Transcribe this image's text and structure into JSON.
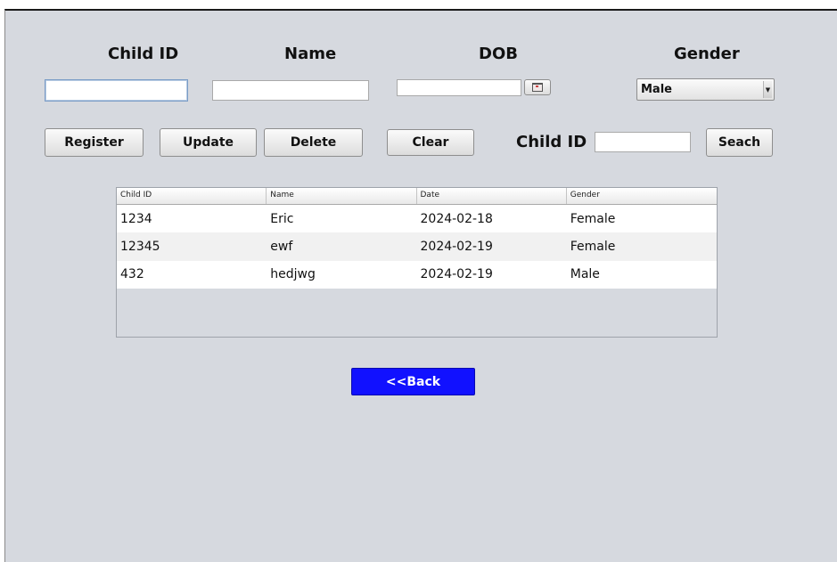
{
  "form": {
    "headers": {
      "child_id": "Child ID",
      "name": "Name",
      "dob": "DOB",
      "gender": "Gender"
    },
    "child_id_value": "",
    "name_value": "",
    "dob_value": "",
    "gender_selected": "Male"
  },
  "buttons": {
    "register": "Register",
    "update": "Update",
    "delete": "Delete",
    "clear": "Clear",
    "search": "Seach",
    "back": "<<Back"
  },
  "search": {
    "label": "Child ID",
    "value": ""
  },
  "icons": {
    "date_picker": "calendar-icon",
    "combo_arrow": "chevron-down-icon"
  },
  "colors": {
    "panel_bg": "#d6d9df",
    "back_button_bg": "#1111ff"
  },
  "table": {
    "columns": [
      "Child ID",
      "Name",
      "Date",
      "Gender"
    ],
    "rows": [
      [
        "1234",
        "Eric",
        "2024-02-18",
        "Female"
      ],
      [
        "12345",
        "ewf",
        "2024-02-19",
        "Female"
      ],
      [
        "432",
        "hedjwg",
        "2024-02-19",
        "Male"
      ]
    ]
  }
}
